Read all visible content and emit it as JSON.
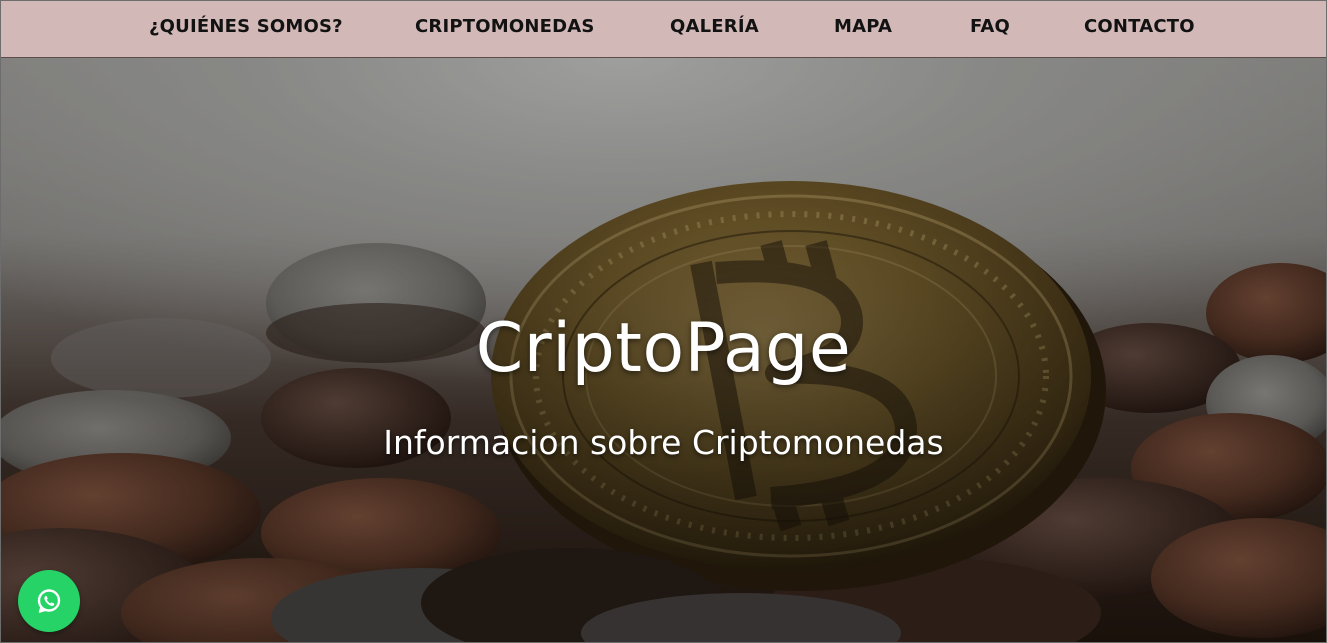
{
  "nav": {
    "items": [
      {
        "label": "¿QUIÉNES SOMOS?"
      },
      {
        "label": "CRIPTOMONEDAS"
      },
      {
        "label": "QALERÍA"
      },
      {
        "label": "MAPA"
      },
      {
        "label": "FAQ"
      },
      {
        "label": "CONTACTO"
      }
    ]
  },
  "hero": {
    "title": "CriptoPage",
    "subtitle": "Informacion sobre Criptomonedas",
    "background_image": "bitcoin-coin-pile-photo"
  },
  "whatsapp": {
    "icon": "whatsapp-icon",
    "color": "#25d366"
  },
  "colors": {
    "navbar_bg": "#d2b9b8",
    "nav_text": "#121212",
    "hero_text": "#ffffff"
  }
}
